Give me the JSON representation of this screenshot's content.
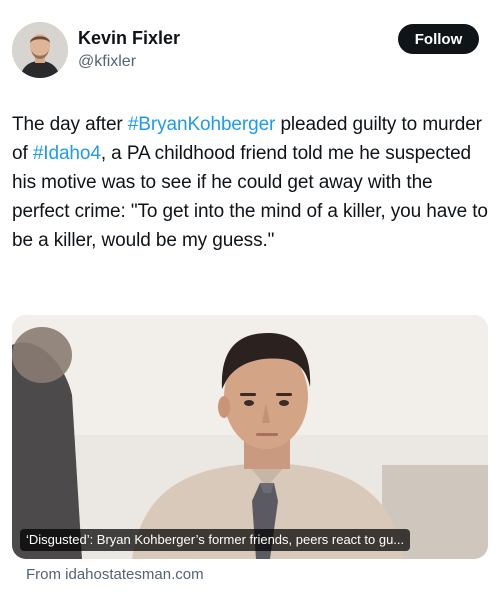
{
  "author": {
    "name": "Kevin Fixler",
    "handle": "@kfixler",
    "follow_label": "Follow"
  },
  "tweet": {
    "segments": [
      {
        "text": "The day after ",
        "hashtag": false
      },
      {
        "text": "#BryanKohberger",
        "hashtag": true
      },
      {
        "text": " pleaded guilty to murder of ",
        "hashtag": false
      },
      {
        "text": "#Idaho4",
        "hashtag": true
      },
      {
        "text": ", a PA childhood friend told me he suspected his motive was to see if he could get away with the perfect crime: \"To get into the mind of a killer, you have to be a killer, would be my guess.\"",
        "hashtag": false
      }
    ]
  },
  "link_card": {
    "caption": "‘Disgusted’: Bryan Kohberger’s former friends, peers react to gu...",
    "source": "From idahostatesman.com"
  },
  "colors": {
    "text": "#0f1419",
    "secondary": "#536471",
    "hashtag": "#1d9bf0",
    "button_bg": "#0f1419"
  }
}
